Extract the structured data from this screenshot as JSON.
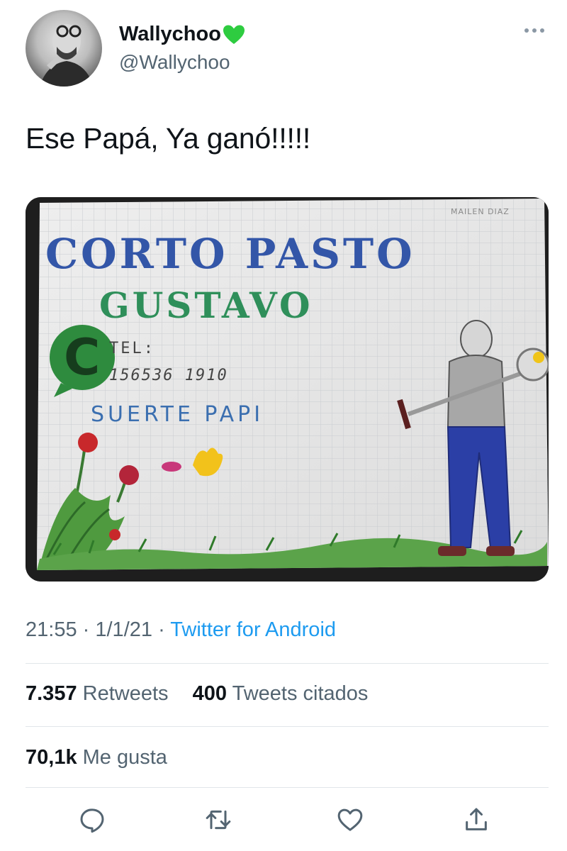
{
  "tweet": {
    "display_name": "Wallychoo",
    "handle": "@Wallychoo",
    "badge_icon": "green-heart-icon",
    "text": "Ese Papá, Ya ganó!!!!!",
    "time": "21:55",
    "date": "1/1/21",
    "separator": "·",
    "source": "Twitter for Android"
  },
  "media": {
    "drawing_text": {
      "signature": "MAILEN DIAZ",
      "line1": "CORTO PASTO",
      "line2": "GUSTAVO",
      "tel_label": "TEL:",
      "tel_number": "156536 1910",
      "wish": "SUERTE PAPI"
    }
  },
  "stats": {
    "retweets_count": "7.357",
    "retweets_label": "Retweets",
    "quotes_count": "400",
    "quotes_label": "Tweets citados",
    "likes_count": "70,1k",
    "likes_label": "Me gusta"
  },
  "actions": {
    "icons": [
      "reply-icon",
      "retweet-icon",
      "like-icon",
      "share-icon"
    ]
  },
  "colors": {
    "link": "#1d9bf0",
    "secondary_text": "#536471",
    "heart": "#2ecc40"
  }
}
